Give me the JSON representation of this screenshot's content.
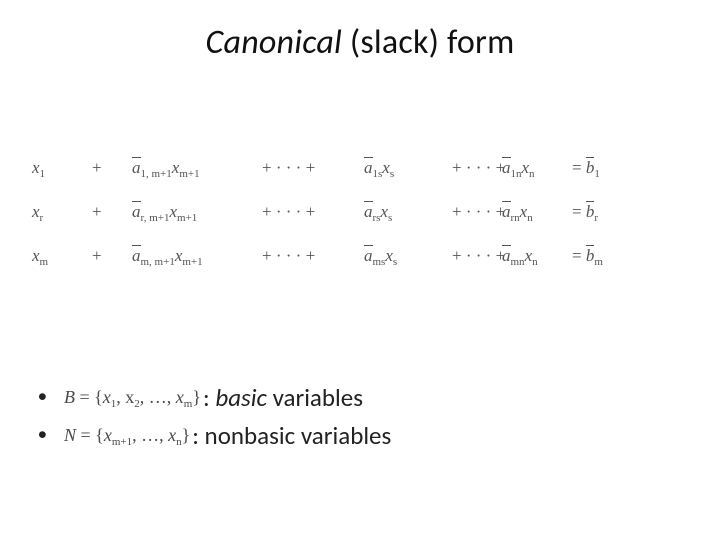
{
  "title": {
    "canonical": "Canonical",
    "rest": " (slack) form"
  },
  "equations": [
    {
      "lead": "x",
      "lead_sub": "1",
      "a1": "a",
      "a1_sub": "1, m+1",
      "a1x": "x",
      "a1x_sub": "m+1",
      "a2": "a",
      "a2_sub": "1s",
      "a2x": "x",
      "a2x_sub": "s",
      "a3": "a",
      "a3_sub": "1n",
      "a3x": "x",
      "a3x_sub": "n",
      "b": "b",
      "b_sub": "1"
    },
    {
      "lead": "x",
      "lead_sub": "r",
      "a1": "a",
      "a1_sub": "r, m+1",
      "a1x": "x",
      "a1x_sub": "m+1",
      "a2": "a",
      "a2_sub": "rs",
      "a2x": "x",
      "a2x_sub": "s",
      "a3": "a",
      "a3_sub": "rn",
      "a3x": "x",
      "a3x_sub": "n",
      "b": "b",
      "b_sub": "r"
    },
    {
      "lead": "x",
      "lead_sub": "m",
      "a1": "a",
      "a1_sub": "m, m+1",
      "a1x": "x",
      "a1x_sub": "m+1",
      "a2": "a",
      "a2_sub": "ms",
      "a2x": "x",
      "a2x_sub": "s",
      "a3": "a",
      "a3_sub": "mn",
      "a3x": "x",
      "a3x_sub": "n",
      "b": "b",
      "b_sub": "m"
    }
  ],
  "syms": {
    "plus": "+",
    "dots": "· · · +",
    "eq": "=",
    "ldots": ", …,",
    "braceL": "{",
    "braceR": "}"
  },
  "bullets": [
    {
      "lhs": "B",
      "eqsym": " = ",
      "set_pre": "x",
      "set_sub1": "1",
      "set_mid": ", x",
      "set_sub2": "2",
      "set_dots": ", …, ",
      "set_last": "x",
      "set_sublast": "m",
      "suffix": ": ",
      "emph": "basic",
      "tail": " variables"
    },
    {
      "lhs": "N",
      "eqsym": " = ",
      "set_pre": "x",
      "set_sub1": "m+1",
      "set_mid": "",
      "set_sub2": "",
      "set_dots": ", …, ",
      "set_last": "x",
      "set_sublast": "n",
      "suffix": " : nonbasic variables",
      "emph": "",
      "tail": ""
    }
  ]
}
